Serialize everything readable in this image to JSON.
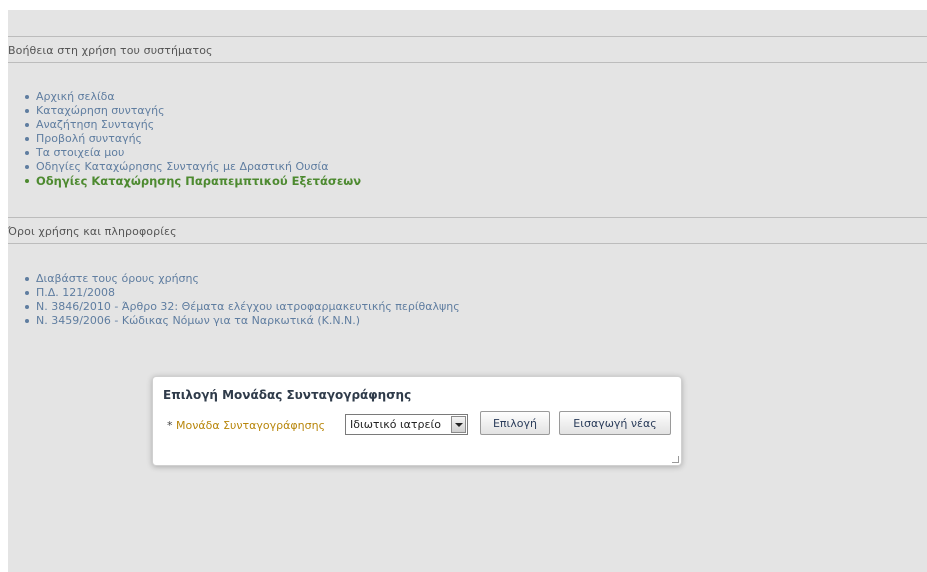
{
  "help_section": {
    "title": "Βοήθεια στη χρήση του συστήματος",
    "links": [
      {
        "label": "Αρχική σελίδα"
      },
      {
        "label": "Καταχώρηση συνταγής"
      },
      {
        "label": "Αναζήτηση Συνταγής"
      },
      {
        "label": "Προβολή συνταγής"
      },
      {
        "label": "Τα στοιχεία μου"
      },
      {
        "label": "Οδηγίες Καταχώρησης Συνταγής με Δραστική Ουσία"
      },
      {
        "label": "Οδηγίες Καταχώρησης Παραπεμπτικού Εξετάσεων",
        "active": true
      }
    ]
  },
  "terms_section": {
    "title": "Όροι χρήσης και πληροφορίες",
    "links": [
      {
        "label": "Διαβάστε τους όρους χρήσης"
      },
      {
        "label": "Π.Δ. 121/2008"
      },
      {
        "label": "Ν. 3846/2010 - Άρθρο 32: Θέματα ελέγχου ιατροφαρμακευτικής περίθαλψης"
      },
      {
        "label": "Ν. 3459/2006 - Κώδικας Νόμων για τα Ναρκωτικά (Κ.Ν.Ν.)"
      }
    ]
  },
  "dialog": {
    "title": "Επιλογή Μονάδας Συνταγογράφησης",
    "required_marker": "*",
    "field_label": "Μονάδα Συνταγογράφησης",
    "select_value": "Ιδιωτικό ιατρείο",
    "select_button": "Επιλογή",
    "new_button": "Εισαγωγή νέας"
  },
  "colors": {
    "background": "#e4e4e4",
    "link": "#5f7da0",
    "active_link": "#4d8a30",
    "field_label": "#b8860b"
  }
}
